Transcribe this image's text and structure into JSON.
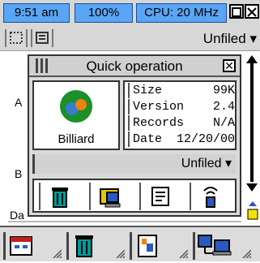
{
  "status": {
    "time": "9:51 am",
    "battery": "100%",
    "cpu": "CPU: 20 MHz"
  },
  "toolbar": {
    "category": "Unfiled"
  },
  "background": {
    "letter_a": "A",
    "letter_b": "B",
    "letter_d": "Da"
  },
  "dialog": {
    "title": "Quick operation",
    "app_name": "Billiard",
    "info": [
      {
        "label": "Size",
        "value": "99K"
      },
      {
        "label": "Version",
        "value": "2.4"
      },
      {
        "label": "Records",
        "value": "N/A"
      },
      {
        "label": "Date",
        "value": "12/20/00"
      }
    ],
    "category": "Unfiled",
    "actions": [
      "trash-icon",
      "folder-pc-icon",
      "notes-icon",
      "beam-icon"
    ]
  },
  "commandbar": {
    "items": [
      "launcher-icon",
      "trash-icon",
      "info-icon",
      "hotsync-icon"
    ]
  },
  "colors": {
    "status_blue": "#5aa5f5",
    "panel_gray": "#d9d9d9",
    "trash_teal": "#009a9a"
  }
}
